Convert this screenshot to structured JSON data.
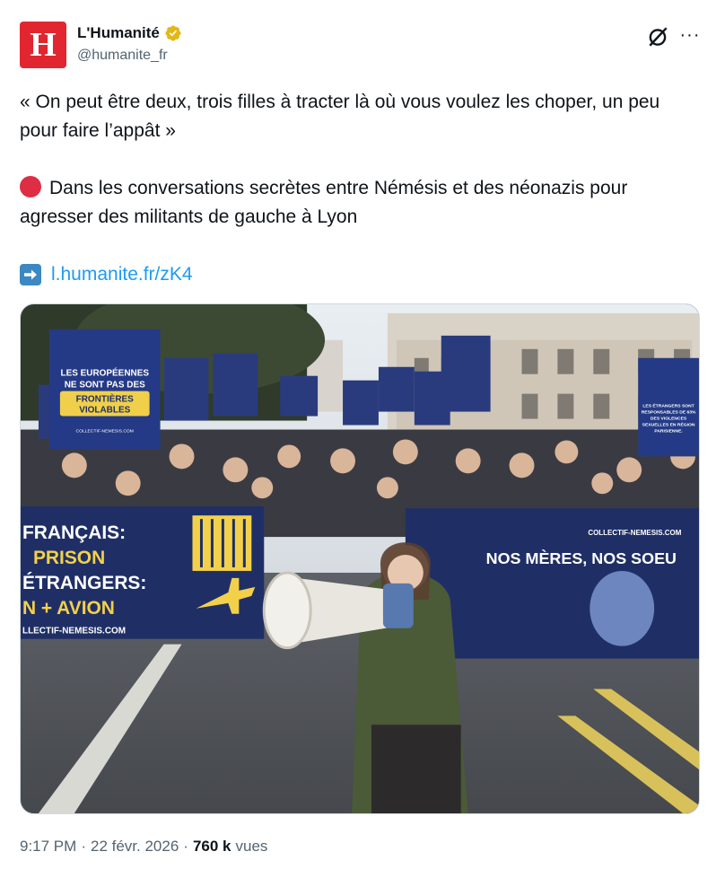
{
  "author": {
    "avatar_letter": "H",
    "display_name": "L'Humanité",
    "handle": "@humanite_fr",
    "verified_icon": "verified-gold-badge-icon",
    "brand_color": "#e2262f"
  },
  "actions": {
    "grok_icon": "grok-icon",
    "more_icon": "more-options-icon",
    "more_glyph": "···"
  },
  "tweet": {
    "quote": "« On peut être deux, trois filles à tracter là où vous voulez les choper, un peu pour faire l’appât »",
    "body_emoji": "red-circle-icon",
    "body": "Dans les conversations secrètes entre Némésis et des néonazis pour agresser des militants de gauche à Lyon",
    "link_emoji": "right-arrow-icon",
    "link_text": "l.humanite.fr/zK4"
  },
  "media": {
    "banner_left_lines": [
      "FRANÇAIS:",
      "PRISON",
      "ÉTRANGERS:",
      "N + AVION",
      "LLECTIF-NEMESIS.COM"
    ],
    "banner_right_text": "NOS MÈRES, NOS SOEU",
    "banner_right_url": "COLLECTIF-NEMESIS.COM",
    "sign_main": [
      "LES EUROPÉENNES",
      "NE SONT PAS DES",
      "FRONTIÈRES",
      "VIOLABLES",
      "COLLECTIF-NEMESIS.COM"
    ],
    "sign_right": [
      "LES ÉTRANGERS SONT",
      "RESPONSABLES DE 63%",
      "DES VIOLENCES",
      "SEXUELLES EN RÉGION",
      "PARISIENNE."
    ]
  },
  "meta": {
    "time": "9:17 PM",
    "separator": "·",
    "date": "22 févr. 2026",
    "views_count": "760 k",
    "views_label": "vues"
  },
  "colors": {
    "text_primary": "#0f1419",
    "text_secondary": "#536471",
    "link": "#1d9bf0",
    "banner_navy": "#1f2f66",
    "banner_yellow": "#f3d04a"
  }
}
